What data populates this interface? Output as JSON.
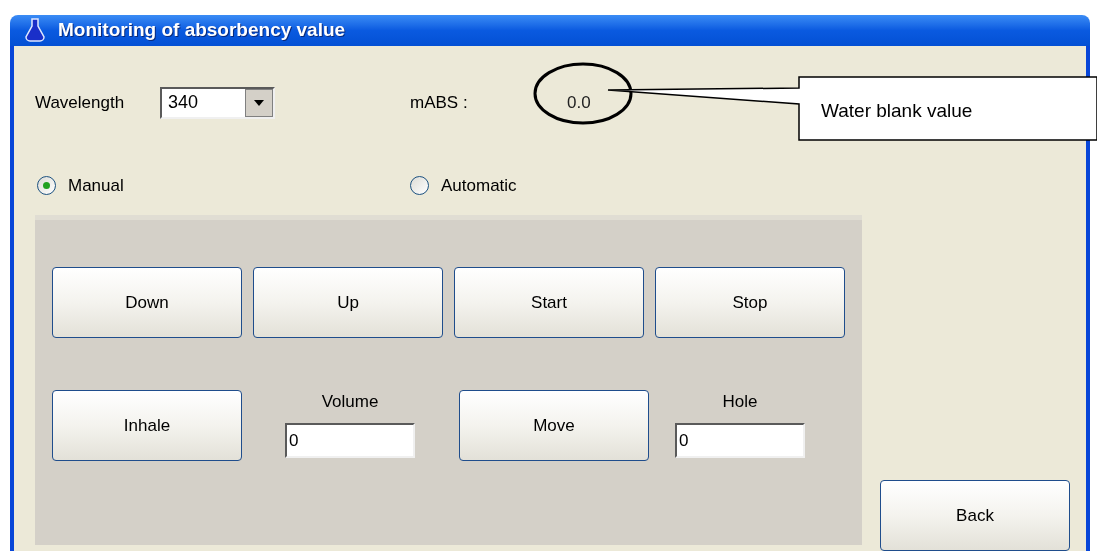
{
  "window": {
    "title": "Monitoring of absorbency value"
  },
  "wavelength": {
    "label": "Wavelength",
    "value": "340"
  },
  "absorbance": {
    "label": "mABS :",
    "value": "0.0"
  },
  "modes": [
    {
      "label": "Manual",
      "selected": true
    },
    {
      "label": "Automatic",
      "selected": false
    }
  ],
  "control_buttons": [
    "Down",
    "Up",
    "Start",
    "Stop"
  ],
  "actions": [
    {
      "kind": "button",
      "label": "Inhale"
    },
    {
      "kind": "field",
      "label": "Volume",
      "value": "0"
    },
    {
      "kind": "button",
      "label": "Move"
    },
    {
      "kind": "field",
      "label": "Hole",
      "value": "0"
    }
  ],
  "back_button": "Back",
  "annotation": {
    "text": "Water blank value"
  }
}
